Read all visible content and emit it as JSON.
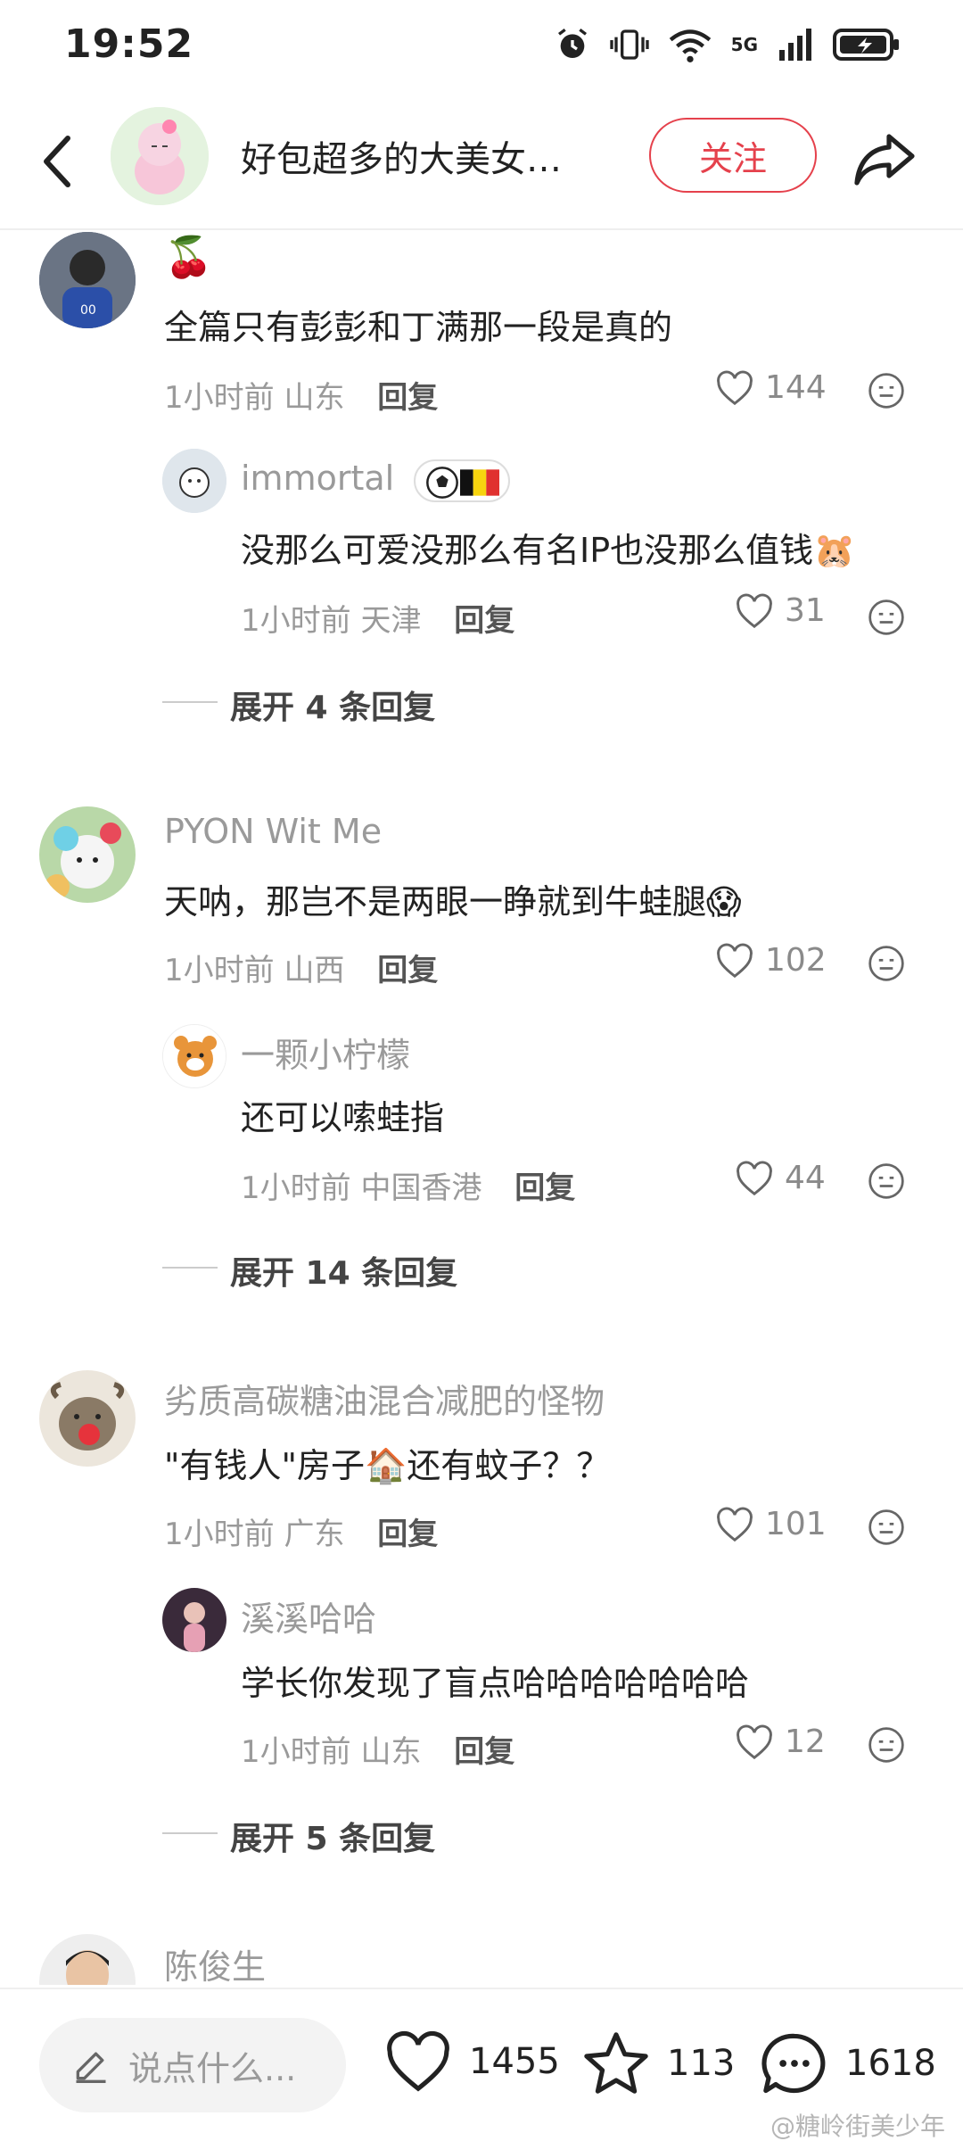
{
  "status_bar": {
    "time": "19:52",
    "network": "5G"
  },
  "header": {
    "title": "好包超多的大美女…",
    "follow_label": "关注"
  },
  "comments": [
    {
      "user": "",
      "user_emoji": "🍒",
      "text": "全篇只有彭彭和丁满那一段是真的",
      "time": "1小时前",
      "location": "山东",
      "reply_label": "回复",
      "likes": "144",
      "reply": {
        "user": "immortal",
        "badge": "⚽🇧🇪",
        "text": "没那么可爱没那么有名IP也没那么值钱🐹",
        "time": "1小时前",
        "location": "天津",
        "reply_label": "回复",
        "likes": "31"
      },
      "expand_label": "展开 4 条回复"
    },
    {
      "user": "PYON Wit Me",
      "text": "天呐，那岂不是两眼一睁就到牛蛙腿😱",
      "time": "1小时前",
      "location": "山西",
      "reply_label": "回复",
      "likes": "102",
      "reply": {
        "user": "一颗小柠檬",
        "text": "还可以嗦蛙指",
        "time": "1小时前",
        "location": "中国香港",
        "reply_label": "回复",
        "likes": "44"
      },
      "expand_label": "展开 14 条回复"
    },
    {
      "user": "劣质高碳糖油混合减肥的怪物",
      "text": "\"有钱人\"房子🏠还有蚊子？？",
      "time": "1小时前",
      "location": "广东",
      "reply_label": "回复",
      "likes": "101",
      "reply": {
        "user": "溪溪哈哈",
        "text": "学长你发现了盲点哈哈哈哈哈哈哈",
        "time": "1小时前",
        "location": "山东",
        "reply_label": "回复",
        "likes": "12"
      },
      "expand_label": "展开 5 条回复"
    },
    {
      "user": "陈俊生"
    }
  ],
  "bottom_bar": {
    "input_placeholder": "说点什么...",
    "likes": "1455",
    "favorites": "113",
    "comments": "1618",
    "watermark": "@糖岭街美少年"
  }
}
